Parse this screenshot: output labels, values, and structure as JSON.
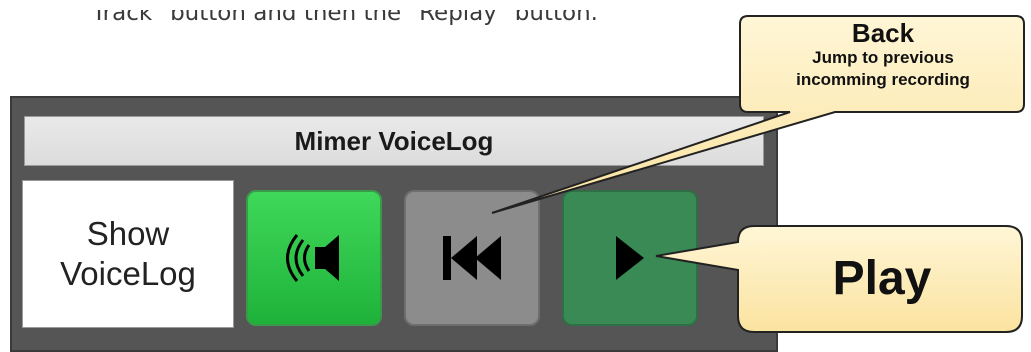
{
  "intro": {
    "text": "Track\" button and then the \"Replay\" button."
  },
  "panel": {
    "title": "Mimer VoiceLog",
    "show_button_line1": "Show",
    "show_button_line2": "VoiceLog"
  },
  "buttons": {
    "volume_icon": "speaker-sound-icon",
    "back_icon": "skip-back-icon",
    "play_icon": "play-icon"
  },
  "callouts": {
    "back": {
      "title": "Back",
      "subtitle_line1": "Jump to previous",
      "subtitle_line2": "incomming recording"
    },
    "play": {
      "title": "Play"
    }
  },
  "colors": {
    "panel_bg": "#555555",
    "callout_fill": "#fde9a8",
    "volume_green": "#2ccf49",
    "play_green": "#3a8a55",
    "back_grey": "#8c8c8c"
  }
}
